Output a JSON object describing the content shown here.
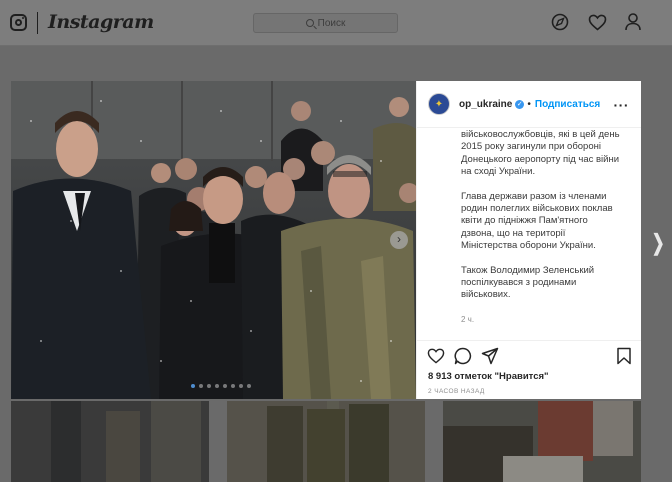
{
  "header": {
    "brand": "Instagram",
    "search_placeholder": "Поиск"
  },
  "post": {
    "username": "op_ukraine",
    "follow_label": "Подписаться",
    "caption_paragraphs": [
      "військовослужбовців, які в цей день 2015 року загинули при обороні Донецького аеропорту під час війни на сході України.",
      "Глава держави разом із членами родин полеглих військових поклав квіти до підніжжя Пам'ятного дзвона, що на території Міністерства оборони України.",
      "Також Володимир Зеленський поспілкувався з родинами військових."
    ],
    "caption_time": "2 ч.",
    "likes_text": "8 913 отметок \"Нравится\"",
    "posted_time": "2 ЧАСОВ НАЗАД",
    "carousel_dots": 8,
    "active_dot": 0
  },
  "colors": {
    "accent": "#0095f6",
    "verified": "#3897f0",
    "overlay": "#6a6a6a"
  },
  "icons": [
    "instagram-logo-icon",
    "search-icon",
    "explore-compass-icon",
    "heart-icon",
    "profile-icon",
    "verified-badge-icon",
    "more-options-icon",
    "like-heart-icon",
    "comment-icon",
    "share-icon",
    "bookmark-icon",
    "carousel-next-icon",
    "next-post-icon"
  ]
}
